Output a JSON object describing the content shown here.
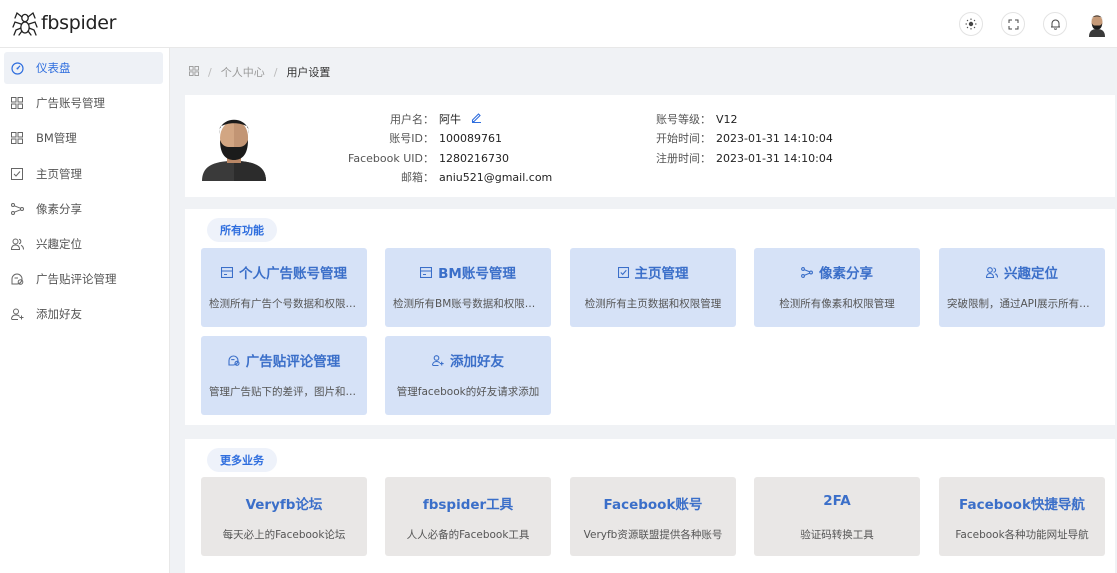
{
  "brand": {
    "name": "fbspider"
  },
  "menu": [
    {
      "label": "仪表盘",
      "icon": "dashboard-icon"
    },
    {
      "label": "广告账号管理",
      "icon": "grid-icon"
    },
    {
      "label": "BM管理",
      "icon": "grid-icon"
    },
    {
      "label": "主页管理",
      "icon": "page-check-icon"
    },
    {
      "label": "像素分享",
      "icon": "share-icon"
    },
    {
      "label": "兴趣定位",
      "icon": "users-icon"
    },
    {
      "label": "广告贴评论管理",
      "icon": "comment-manage-icon"
    },
    {
      "label": "添加好友",
      "icon": "add-user-icon"
    }
  ],
  "breadcrumb": {
    "level1": "个人中心",
    "current": "用户设置"
  },
  "profile": {
    "username_label": "用户名：",
    "username": "阿牛",
    "account_id_label": "账号ID：",
    "account_id": "100089761",
    "facebook_uid_label": "Facebook UID：",
    "facebook_uid": "1280216730",
    "email_label": "邮箱：",
    "email": "aniu521@gmail.com",
    "level_label": "账号等级：",
    "level": "V12",
    "start_label": "开始时间：",
    "start_time": "2023-01-31 14:10:04",
    "register_label": "注册时间：",
    "register_time": "2023-01-31 14:10:04"
  },
  "features": {
    "tag": "所有功能",
    "tiles": [
      {
        "title": "个人广告账号管理",
        "desc": "检测所有广告个号数据和权限管理",
        "icon": "card-icon"
      },
      {
        "title": "BM账号管理",
        "desc": "检测所有BM账号数据和权限管理",
        "icon": "card-icon"
      },
      {
        "title": "主页管理",
        "desc": "检测所有主页数据和权限管理",
        "icon": "page-check-icon"
      },
      {
        "title": "像素分享",
        "desc": "检测所有像素和权限管理",
        "icon": "share-icon"
      },
      {
        "title": "兴趣定位",
        "desc": "突破限制，通过API展示所有兴趣",
        "icon": "users-icon"
      },
      {
        "title": "广告贴评论管理",
        "desc": "管理广告贴下的差评，图片和链接",
        "icon": "comment-manage-icon"
      },
      {
        "title": "添加好友",
        "desc": "管理facebook的好友请求添加",
        "icon": "add-user-icon"
      }
    ]
  },
  "more": {
    "tag": "更多业务",
    "tiles": [
      {
        "title": "Veryfb论坛",
        "desc": "每天必上的Facebook论坛"
      },
      {
        "title": "fbspider工具",
        "desc": "人人必备的Facebook工具"
      },
      {
        "title": "Facebook账号",
        "desc": "Veryfb资源联盟提供各种账号"
      },
      {
        "title": "2FA",
        "desc": "验证码转换工具"
      },
      {
        "title": "Facebook快捷导航",
        "desc": "Facebook各种功能网址导航"
      }
    ]
  },
  "colors": {
    "accent": "#2f6ede",
    "tile_blue": "#d6e2f7",
    "tile_grey": "#e9e7e6",
    "title_blue": "#3b6fc9"
  }
}
